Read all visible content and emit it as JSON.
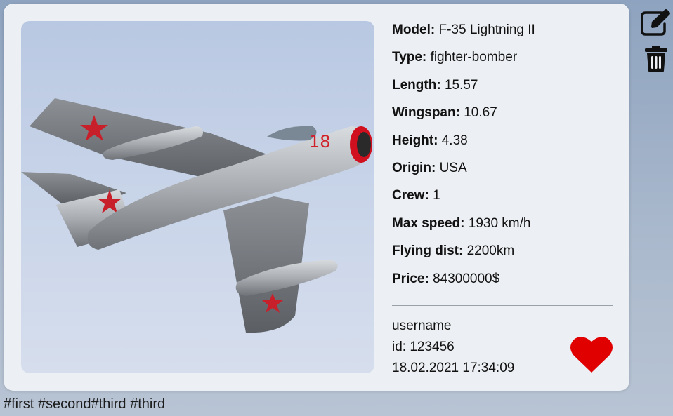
{
  "details": {
    "model": {
      "label": "Model:",
      "value": "F-35 Lightning II"
    },
    "type": {
      "label": "Type:",
      "value": "fighter-bomber"
    },
    "length": {
      "label": "Length:",
      "value": "15.57"
    },
    "wingspan": {
      "label": "Wingspan:",
      "value": "10.67"
    },
    "height": {
      "label": "Height:",
      "value": "4.38"
    },
    "origin": {
      "label": "Origin:",
      "value": "USA"
    },
    "crew": {
      "label": "Crew:",
      "value": "1"
    },
    "max_speed": {
      "label": "Max speed:",
      "value": "1930 km/h"
    },
    "flying_dist": {
      "label": "Flying dist:",
      "value": "2200km"
    },
    "price": {
      "label": "Price:",
      "value": "84300000$"
    }
  },
  "meta": {
    "username": "username",
    "id": "id: 123456",
    "timestamp": "18.02.2021 17:34:09"
  },
  "tags": "#first #second#third #third",
  "icons": {
    "edit": "edit-icon",
    "delete": "trash-icon",
    "like": "heart-icon"
  },
  "colors": {
    "heart": "#e00000",
    "card_bg": "#eceff3"
  }
}
